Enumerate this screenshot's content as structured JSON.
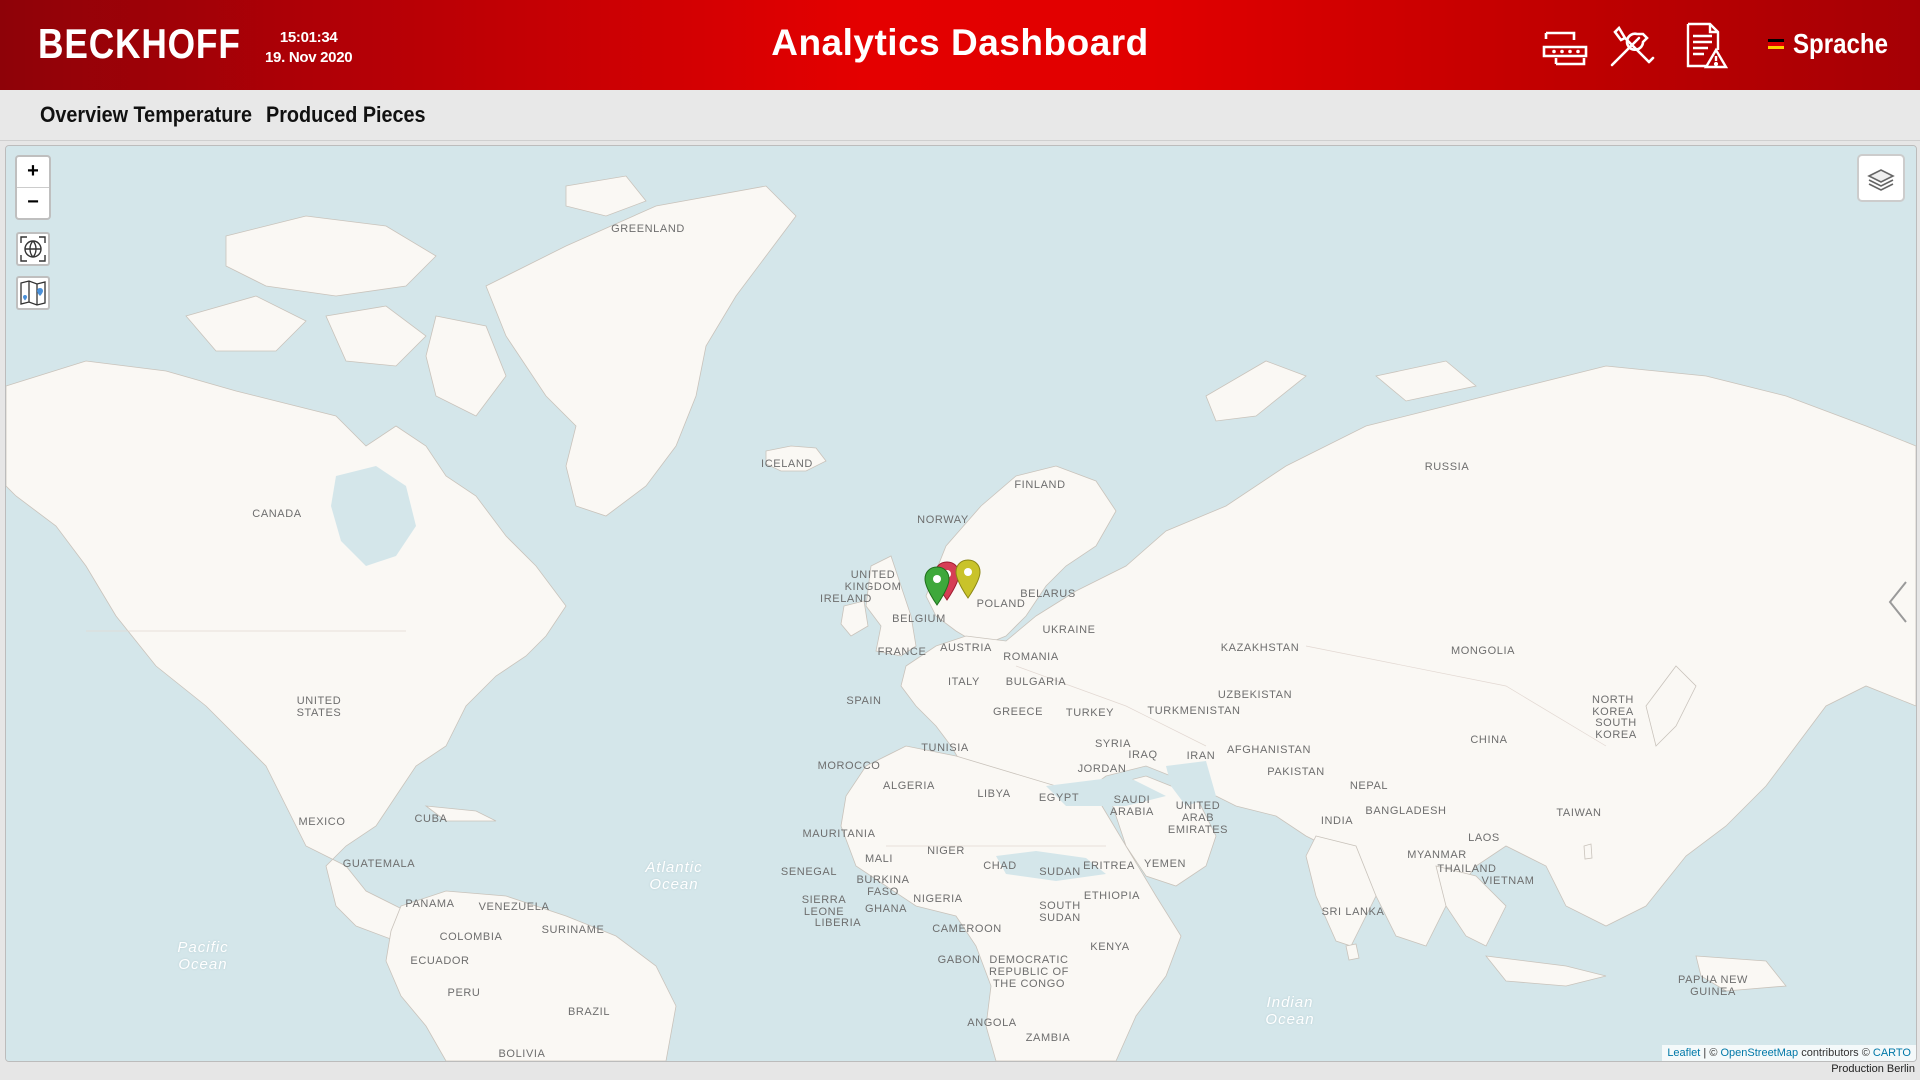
{
  "header": {
    "logo": "BECKHOFF",
    "time": "15:01:34",
    "date": "19. Nov 2020",
    "title": "Analytics Dashboard",
    "icons": [
      "connection-icon",
      "tools-icon",
      "alarm-document-icon"
    ],
    "language_label": "Sprache"
  },
  "nav": {
    "tabs": [
      {
        "label": "Overview Temperature"
      },
      {
        "label": "Produced Pieces"
      }
    ]
  },
  "map": {
    "zoom_in": "+",
    "zoom_out": "−",
    "tools": [
      "fullscreen-icon",
      "locate-map-icon"
    ],
    "layers_icon": "layers-icon",
    "labels": [
      {
        "text": "GREENLAND"
      },
      {
        "text": "ICELAND"
      },
      {
        "text": "CANADA"
      },
      {
        "text": "UNITED\nSTATES"
      },
      {
        "text": "MEXICO"
      },
      {
        "text": "CUBA"
      },
      {
        "text": "GUATEMALA"
      },
      {
        "text": "PANAMA"
      },
      {
        "text": "VENEZUELA"
      },
      {
        "text": "COLOMBIA"
      },
      {
        "text": "SURINAME"
      },
      {
        "text": "ECUADOR"
      },
      {
        "text": "PERU"
      },
      {
        "text": "BRAZIL"
      },
      {
        "text": "BOLIVIA"
      },
      {
        "text": "NORWAY"
      },
      {
        "text": "FINLAND"
      },
      {
        "text": "UNITED\nKINGDOM"
      },
      {
        "text": "IRELAND"
      },
      {
        "text": "BELGIUM"
      },
      {
        "text": "POLAND"
      },
      {
        "text": "BELARUS"
      },
      {
        "text": "UKRAINE"
      },
      {
        "text": "AUSTRIA"
      },
      {
        "text": "FRANCE"
      },
      {
        "text": "ROMANIA"
      },
      {
        "text": "ITALY"
      },
      {
        "text": "BULGARIA"
      },
      {
        "text": "SPAIN"
      },
      {
        "text": "GREECE"
      },
      {
        "text": "TURKEY"
      },
      {
        "text": "TUNISIA"
      },
      {
        "text": "MOROCCO"
      },
      {
        "text": "ALGERIA"
      },
      {
        "text": "LIBYA"
      },
      {
        "text": "EGYPT"
      },
      {
        "text": "MAURITANIA"
      },
      {
        "text": "MALI"
      },
      {
        "text": "NIGER"
      },
      {
        "text": "CHAD"
      },
      {
        "text": "SUDAN"
      },
      {
        "text": "SENEGAL"
      },
      {
        "text": "BURKINA\nFASO"
      },
      {
        "text": "NIGERIA"
      },
      {
        "text": "SIERRA\nLEONE"
      },
      {
        "text": "LIBERIA"
      },
      {
        "text": "GHANA"
      },
      {
        "text": "CAMEROON"
      },
      {
        "text": "GABON"
      },
      {
        "text": "DEMOCRATIC\nREPUBLIC OF\nTHE CONGO"
      },
      {
        "text": "SOUTH\nSUDAN"
      },
      {
        "text": "ETHIOPIA"
      },
      {
        "text": "ERITREA"
      },
      {
        "text": "KENYA"
      },
      {
        "text": "ANGOLA"
      },
      {
        "text": "ZAMBIA"
      },
      {
        "text": "SAUDI\nARABIA"
      },
      {
        "text": "YEMEN"
      },
      {
        "text": "UNITED\nARAB\nEMIRATES"
      },
      {
        "text": "SYRIA"
      },
      {
        "text": "IRAQ"
      },
      {
        "text": "JORDAN"
      },
      {
        "text": "IRAN"
      },
      {
        "text": "AFGHANISTAN"
      },
      {
        "text": "PAKISTAN"
      },
      {
        "text": "TURKMENISTAN"
      },
      {
        "text": "UZBEKISTAN"
      },
      {
        "text": "KAZAKHSTAN"
      },
      {
        "text": "RUSSIA"
      },
      {
        "text": "MONGOLIA"
      },
      {
        "text": "CHINA"
      },
      {
        "text": "NORTH\nKOREA"
      },
      {
        "text": "SOUTH\nKOREA"
      },
      {
        "text": "NEPAL"
      },
      {
        "text": "INDIA"
      },
      {
        "text": "BANGLADESH"
      },
      {
        "text": "MYANMAR"
      },
      {
        "text": "THAILAND"
      },
      {
        "text": "LAOS"
      },
      {
        "text": "VIETNAM"
      },
      {
        "text": "TAIWAN"
      },
      {
        "text": "SRI LANKA"
      },
      {
        "text": "PAPUA NEW\nGUINEA"
      }
    ],
    "oceans": [
      {
        "text": "Atlantic\nOcean"
      },
      {
        "text": "Pacific\nOcean"
      },
      {
        "text": "Indian\nOcean"
      }
    ],
    "markers": [
      {
        "color": "#d63e55",
        "name": "red-marker"
      },
      {
        "color": "#c9c32a",
        "name": "yellow-marker"
      },
      {
        "color": "#3ea83b",
        "name": "green-marker"
      }
    ],
    "attribution": {
      "leaflet": "Leaflet",
      "sep": " | © ",
      "osm": "OpenStreetMap",
      "mid": " contributors © ",
      "carto": "CARTO"
    }
  },
  "footer": {
    "status": "Production Berlin"
  },
  "colors": {
    "header_red": "#e40000",
    "land": "#faf8f4",
    "water": "#d4e6ea",
    "nav_bg": "#e8e8e8"
  }
}
